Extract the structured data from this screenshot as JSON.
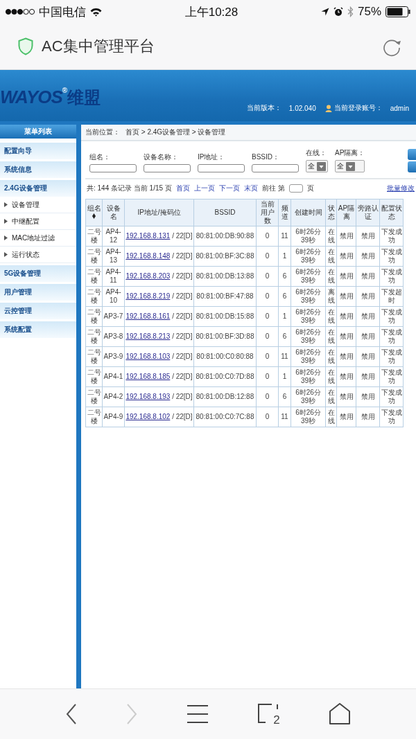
{
  "status_bar": {
    "carrier": "中国电信",
    "time": "上午10:28",
    "battery": "75%"
  },
  "browser_bar": {
    "title": "AC集中管理平台"
  },
  "header": {
    "logo": "WAYOS",
    "logo_mark": "®",
    "logo_cn": "维盟",
    "version_label": "当前版本：",
    "version": "1.02.040",
    "account_label": "当前登录账号：",
    "account": "admin"
  },
  "sidebar": {
    "title": "菜单列表",
    "items": [
      {
        "label": "配置向导"
      },
      {
        "label": "系统信息"
      },
      {
        "label": "2.4G设备管理",
        "children": [
          {
            "label": "设备管理"
          },
          {
            "label": "中继配置"
          },
          {
            "label": "MAC地址过滤"
          },
          {
            "label": "运行状态"
          }
        ]
      },
      {
        "label": "5G设备管理"
      },
      {
        "label": "用户管理"
      },
      {
        "label": "云控管理"
      },
      {
        "label": "系统配置"
      }
    ]
  },
  "breadcrumb": {
    "label": "当前位置：",
    "path": "首页 > 2.4G设备管理 > 设备管理"
  },
  "filters": [
    {
      "kind": "text",
      "label": "组名："
    },
    {
      "kind": "text",
      "label": "设备名称："
    },
    {
      "kind": "text",
      "label": "IP地址："
    },
    {
      "kind": "text",
      "label": "BSSID："
    },
    {
      "kind": "select",
      "label": "在线：",
      "value": "全"
    },
    {
      "kind": "select",
      "label": "AP隔离：",
      "value": "全"
    }
  ],
  "pager": {
    "summary": "共: 144 条记录 当前 1/15 页",
    "links": [
      "首页",
      "上一页",
      "下一页",
      "末页"
    ],
    "goto_label": "前往 第",
    "goto_suffix": "页",
    "batch_link": "批量修改"
  },
  "table": {
    "columns": [
      "组名",
      "设备名",
      "IP地址/掩码位",
      "BSSID",
      "当前用户数",
      "频道",
      "创建时间",
      "状态",
      "AP隔离",
      "旁路认证",
      "配置状态"
    ],
    "rows": [
      {
        "group": "二号楼",
        "device": "AP4-12",
        "ip": "192.168.8.131",
        "mask": "/ 22[D]",
        "bssid": "80:81:00:DB:90:88",
        "users": "0",
        "channel": "11",
        "created": "6时26分39秒",
        "status": "在线",
        "ap_isolation": "禁用",
        "bypass_auth": "禁用",
        "config": "下发成功"
      },
      {
        "group": "二号楼",
        "device": "AP4-13",
        "ip": "192.168.8.148",
        "mask": "/ 22[D]",
        "bssid": "80:81:00:BF:3C:88",
        "users": "0",
        "channel": "1",
        "created": "6时26分39秒",
        "status": "在线",
        "ap_isolation": "禁用",
        "bypass_auth": "禁用",
        "config": "下发成功"
      },
      {
        "group": "二号楼",
        "device": "AP4-11",
        "ip": "192.168.8.203",
        "mask": "/ 22[D]",
        "bssid": "80:81:00:DB:13:88",
        "users": "0",
        "channel": "6",
        "created": "6时26分39秒",
        "status": "在线",
        "ap_isolation": "禁用",
        "bypass_auth": "禁用",
        "config": "下发成功"
      },
      {
        "group": "二号楼",
        "device": "AP4-10",
        "ip": "192.168.8.219",
        "mask": "/ 22[D]",
        "bssid": "80:81:00:BF:47:88",
        "users": "0",
        "channel": "6",
        "created": "6时26分39秒",
        "status": "离线",
        "ap_isolation": "禁用",
        "bypass_auth": "禁用",
        "config": "下发超时"
      },
      {
        "group": "二号楼",
        "device": "AP3-7",
        "ip": "192.168.8.161",
        "mask": "/ 22[D]",
        "bssid": "80:81:00:DB:15:88",
        "users": "0",
        "channel": "1",
        "created": "6时26分39秒",
        "status": "在线",
        "ap_isolation": "禁用",
        "bypass_auth": "禁用",
        "config": "下发成功"
      },
      {
        "group": "二号楼",
        "device": "AP3-8",
        "ip": "192.168.8.213",
        "mask": "/ 22[D]",
        "bssid": "80:81:00:BF:3D:88",
        "users": "0",
        "channel": "6",
        "created": "6时26分39秒",
        "status": "在线",
        "ap_isolation": "禁用",
        "bypass_auth": "禁用",
        "config": "下发成功"
      },
      {
        "group": "二号楼",
        "device": "AP3-9",
        "ip": "192.168.8.103",
        "mask": "/ 22[D]",
        "bssid": "80:81:00:C0:80:88",
        "users": "0",
        "channel": "11",
        "created": "6时26分39秒",
        "status": "在线",
        "ap_isolation": "禁用",
        "bypass_auth": "禁用",
        "config": "下发成功"
      },
      {
        "group": "二号楼",
        "device": "AP4-1",
        "ip": "192.168.8.185",
        "mask": "/ 22[D]",
        "bssid": "80:81:00:C0:7D:88",
        "users": "0",
        "channel": "1",
        "created": "6时26分39秒",
        "status": "在线",
        "ap_isolation": "禁用",
        "bypass_auth": "禁用",
        "config": "下发成功"
      },
      {
        "group": "二号楼",
        "device": "AP4-2",
        "ip": "192.168.8.193",
        "mask": "/ 22[D]",
        "bssid": "80:81:00:DB:12:88",
        "users": "0",
        "channel": "6",
        "created": "6时26分39秒",
        "status": "在线",
        "ap_isolation": "禁用",
        "bypass_auth": "禁用",
        "config": "下发成功"
      },
      {
        "group": "二号楼",
        "device": "AP4-9",
        "ip": "192.168.8.102",
        "mask": "/ 22[D]",
        "bssid": "80:81:00:C0:7C:88",
        "users": "0",
        "channel": "11",
        "created": "6时26分39秒",
        "status": "在线",
        "ap_isolation": "禁用",
        "bypass_auth": "禁用",
        "config": "下发成功"
      }
    ]
  },
  "toolbar": {
    "back": {
      "disabled": false
    },
    "forward": {
      "disabled": true
    },
    "tab_count": "2"
  }
}
